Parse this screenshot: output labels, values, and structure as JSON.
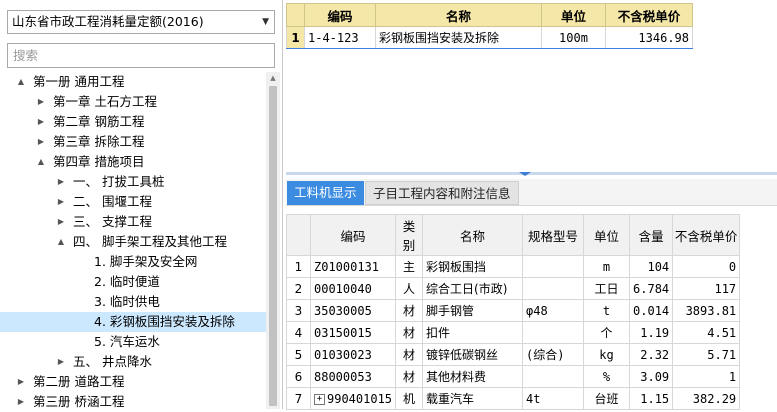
{
  "left": {
    "library_select": "山东省市政工程消耗量定额(2016)",
    "search_placeholder": "搜索",
    "tree": [
      {
        "label": "第一册 通用工程",
        "twisty": "▲",
        "selected": false
      },
      {
        "label": "第一章 土石方工程",
        "twisty": "▶",
        "selected": false
      },
      {
        "label": "第二章 钢筋工程",
        "twisty": "▶",
        "selected": false
      },
      {
        "label": "第三章 拆除工程",
        "twisty": "▶",
        "selected": false
      },
      {
        "label": "第四章 措施项目",
        "twisty": "▲",
        "selected": false
      },
      {
        "label": "一、 打拔工具桩",
        "twisty": "▶",
        "selected": false
      },
      {
        "label": "二、 围堰工程",
        "twisty": "▶",
        "selected": false
      },
      {
        "label": "三、 支撑工程",
        "twisty": "▶",
        "selected": false
      },
      {
        "label": "四、 脚手架工程及其他工程",
        "twisty": "▲",
        "selected": false
      },
      {
        "label": "1. 脚手架及安全网",
        "twisty": "",
        "selected": false
      },
      {
        "label": "2. 临时便道",
        "twisty": "",
        "selected": false
      },
      {
        "label": "3. 临时供电",
        "twisty": "",
        "selected": false
      },
      {
        "label": "4. 彩钢板围挡安装及拆除",
        "twisty": "",
        "selected": true
      },
      {
        "label": "5. 汽车运水",
        "twisty": "",
        "selected": false
      },
      {
        "label": "五、 井点降水",
        "twisty": "▶",
        "selected": false
      },
      {
        "label": "第二册 道路工程",
        "twisty": "▶",
        "selected": false
      },
      {
        "label": "第三册 桥涵工程",
        "twisty": "▶",
        "selected": false
      }
    ]
  },
  "quota_table": {
    "headers": [
      "编码",
      "名称",
      "单位",
      "不含税单价"
    ],
    "rows": [
      {
        "no": "1",
        "code": "1-4-123",
        "name": "彩钢板围挡安装及拆除",
        "unit": "100m",
        "price": "1346.98"
      }
    ]
  },
  "tabs": {
    "active": "工料机显示",
    "inactive": "子目工程内容和附注信息"
  },
  "resource_table": {
    "headers": [
      "",
      "编码",
      "类别",
      "名称",
      "规格型号",
      "单位",
      "含量",
      "不含税单价"
    ],
    "rows": [
      {
        "no": "1",
        "code": "Z01000131",
        "cat": "主",
        "name": "彩钢板围挡",
        "spec": "",
        "unit": "m",
        "qty": "104",
        "price": "0",
        "expandable": false
      },
      {
        "no": "2",
        "code": "00010040",
        "cat": "人",
        "name": "综合工日(市政)",
        "spec": "",
        "unit": "工日",
        "qty": "6.784",
        "price": "117",
        "expandable": false
      },
      {
        "no": "3",
        "code": "35030005",
        "cat": "材",
        "name": "脚手钢管",
        "spec": "φ48",
        "unit": "t",
        "qty": "0.014",
        "price": "3893.81",
        "expandable": false
      },
      {
        "no": "4",
        "code": "03150015",
        "cat": "材",
        "name": "扣件",
        "spec": "",
        "unit": "个",
        "qty": "1.19",
        "price": "4.51",
        "expandable": false
      },
      {
        "no": "5",
        "code": "01030023",
        "cat": "材",
        "name": "镀锌低碳钢丝",
        "spec": "(综合)",
        "unit": "kg",
        "qty": "2.32",
        "price": "5.71",
        "expandable": false
      },
      {
        "no": "6",
        "code": "88000053",
        "cat": "材",
        "name": "其他材料费",
        "spec": "",
        "unit": "%",
        "qty": "3.09",
        "price": "1",
        "expandable": false
      },
      {
        "no": "7",
        "code": "990401015",
        "cat": "机",
        "name": "载重汽车",
        "spec": "4t",
        "unit": "台班",
        "qty": "1.15",
        "price": "382.29",
        "expandable": true
      }
    ]
  }
}
